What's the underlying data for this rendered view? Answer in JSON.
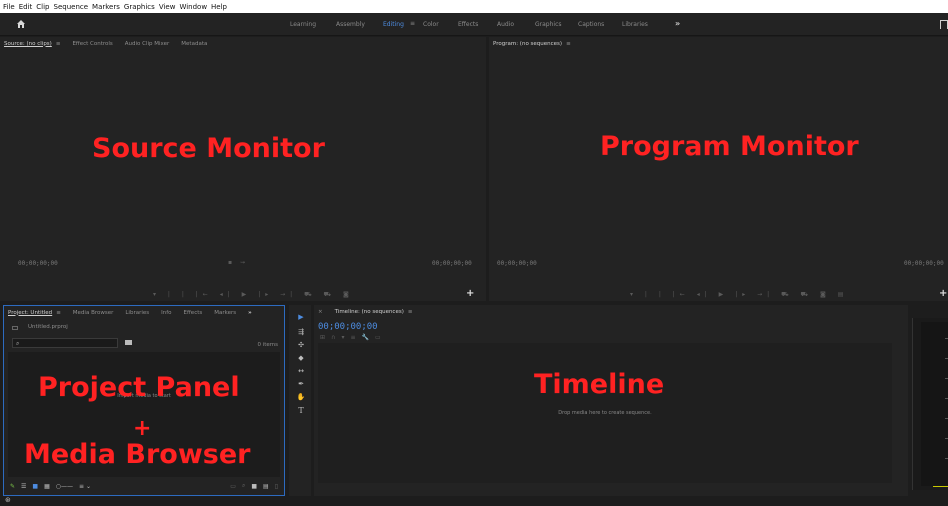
{
  "menu": [
    "File",
    "Edit",
    "Clip",
    "Sequence",
    "Markers",
    "Graphics",
    "View",
    "Window",
    "Help"
  ],
  "workspaces": {
    "tabs": [
      "Learning",
      "Assembly",
      "Editing",
      "Color",
      "Effects",
      "Audio",
      "Graphics",
      "Captions",
      "Libraries"
    ],
    "active": "Editing",
    "more": "»"
  },
  "source": {
    "tabs": [
      "Source: (no clips)",
      "Effect Controls",
      "Audio Clip Mixer",
      "Metadata"
    ],
    "menu": "≡",
    "timecode_left": "00;00;00;00",
    "timecode_right": "00;00;00;00",
    "label": "Source Monitor"
  },
  "program": {
    "tab": "Program: (no sequences)",
    "menu": "≡",
    "timecode_left": "00;00;00;00",
    "timecode_right": "00;00;00;00",
    "label": "Program Monitor"
  },
  "project": {
    "tabs": [
      "Project: Untitled",
      "Media Browser",
      "Libraries",
      "Info",
      "Effects",
      "Markers"
    ],
    "menu": "≡",
    "more": "»",
    "file": "Untitled.prproj",
    "items_count": "0 items",
    "empty_text": "Import media to start",
    "label_line1": "Project Panel",
    "label_plus": "+",
    "label_line2": "Media Browser"
  },
  "timeline": {
    "tab": "Timeline: (no sequences)",
    "menu": "≡",
    "close": "×",
    "timecode": "00;00;00;00",
    "empty_text": "Drop media here to create sequence.",
    "label": "Timeline"
  },
  "colors": {
    "accent": "#4d8ce0",
    "label_red": "#ff2222",
    "panel_bg": "#232323"
  }
}
